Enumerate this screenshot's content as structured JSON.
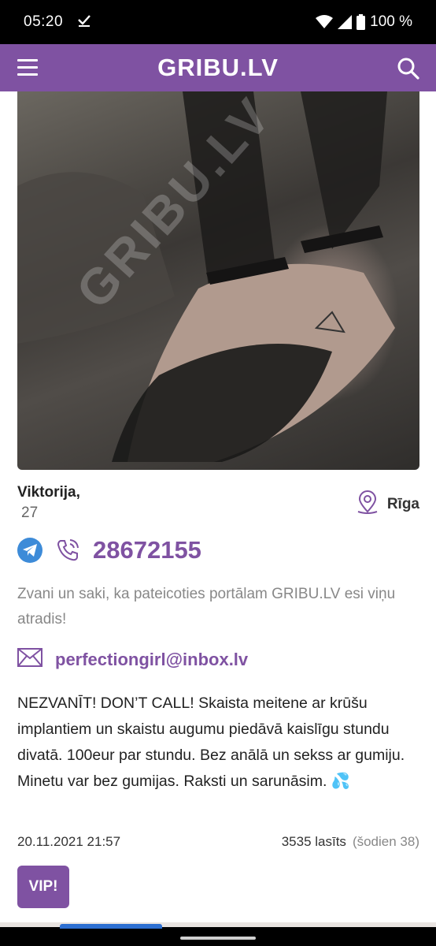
{
  "status_bar": {
    "time": "05:20",
    "battery": "100 %",
    "icons": [
      "check-icon",
      "wifi-icon",
      "signal-icon",
      "battery-icon"
    ]
  },
  "header": {
    "logo": "GRIBU.LV",
    "menu_icon": "hamburger-icon",
    "search_icon": "search-icon",
    "color": "#7f52a2"
  },
  "profile": {
    "photo_watermark": "GRIBU.LV",
    "name": "Viktorija,",
    "age": "27",
    "location": "Rīga",
    "phone": "28672155",
    "hint": "Zvani un saki, ka pateicoties portālam GRIBU.LV esi viņu atradis!",
    "email": "perfectiongirl@inbox.lv",
    "description": "NEZVANĪT! DON’T CALL! Skaista meitene ar krūšu implantiem un skaistu augumu piedāvā kaislīgu stundu divatā. 100eur par stundu. Bez anālā un sekss ar gumiju. Minetu var bez gumijas. Raksti un sarunāsim. 💦",
    "date": "20.11.2021 21:57",
    "reads": "3535 lasīts",
    "reads_today": "(šodien 38)",
    "vip_label": "VIP!"
  }
}
